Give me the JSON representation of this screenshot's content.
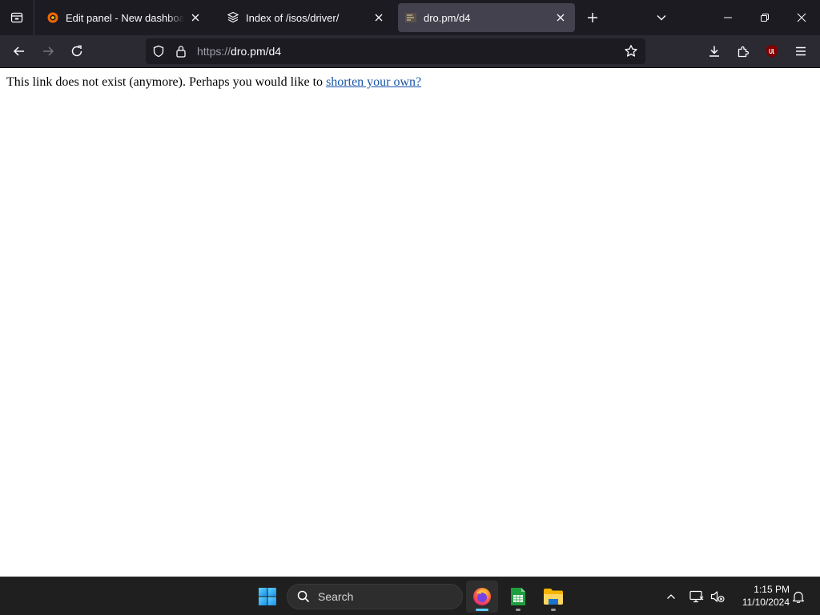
{
  "browser": {
    "tabs": [
      {
        "title": "Edit panel - New dashboard - D",
        "favicon": "grafana-icon"
      },
      {
        "title": "Index of /isos/driver/",
        "favicon": "folder-stack-icon"
      },
      {
        "title": "dro.pm/d4",
        "favicon": "site-icon",
        "active": true
      }
    ],
    "url": {
      "scheme": "https://",
      "rest": "dro.pm/d4"
    }
  },
  "page": {
    "message": "This link does not exist (anymore). Perhaps you would like to ",
    "link_text": "shorten your own?"
  },
  "taskbar": {
    "search_label": "Search",
    "time": "1:15 PM",
    "date": "11/10/2024",
    "apps": [
      "start-icon",
      "firefox-icon",
      "libreoffice-calc-icon",
      "file-explorer-icon"
    ]
  },
  "colors": {
    "tabbar_bg": "#1c1b22",
    "navbar_bg": "#2b2a33",
    "active_tab_bg": "#42414d",
    "link": "#1a56a8",
    "taskbar_bg": "#1f1f1f",
    "ublock_red": "#800000"
  }
}
